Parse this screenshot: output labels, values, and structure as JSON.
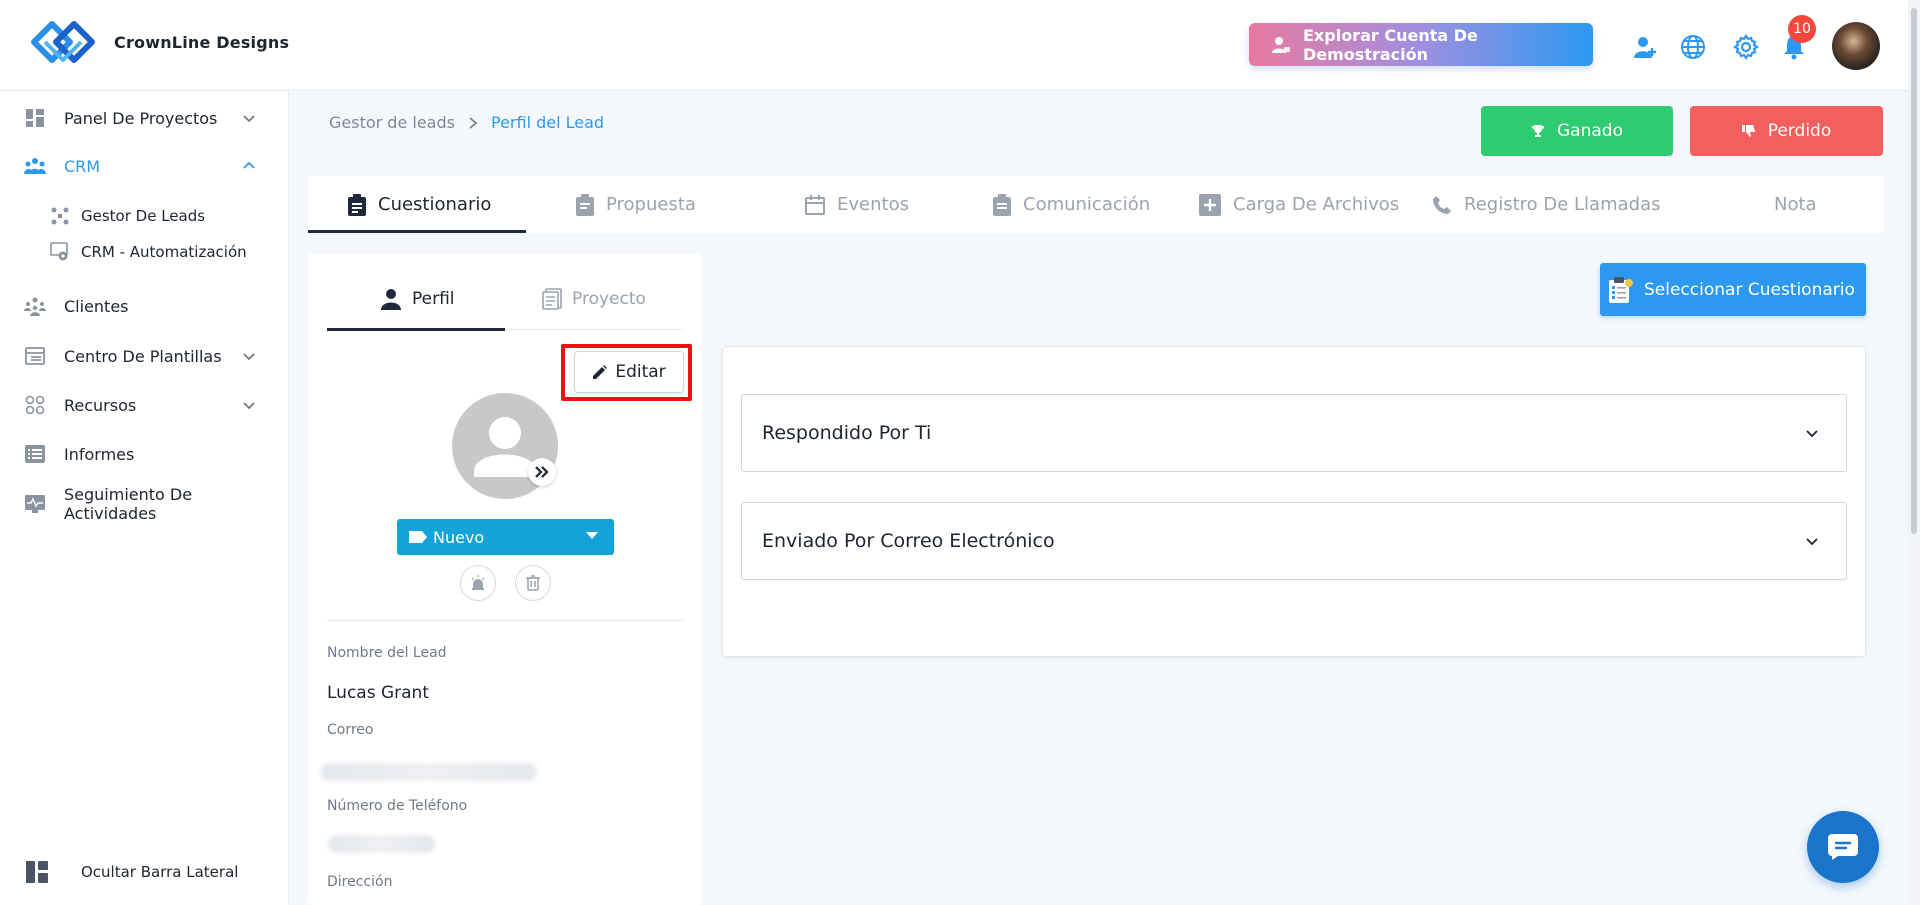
{
  "app": {
    "brand_name": "CrownLine Designs",
    "demo_button_label": "Explorar Cuenta De Demostración",
    "notification_count": "10"
  },
  "sidebar": {
    "items": [
      {
        "label": "Panel De Proyectos",
        "icon": "dashboard-grid-icon",
        "expandable": true
      },
      {
        "label": "CRM",
        "icon": "crm-people-icon",
        "expandable": true,
        "expanded": true,
        "active": true
      },
      {
        "label": "Gestor De Leads",
        "icon": "lead-manager-icon",
        "sub": true
      },
      {
        "label": "CRM - Automatización",
        "icon": "automation-gear-icon",
        "sub": true
      },
      {
        "label": "Clientes",
        "icon": "clients-group-icon"
      },
      {
        "label": "Centro De Plantillas",
        "icon": "template-center-icon",
        "expandable": true
      },
      {
        "label": "Recursos",
        "icon": "resources-icon",
        "expandable": true
      },
      {
        "label": "Informes",
        "icon": "reports-list-icon"
      },
      {
        "label": "Seguimiento De Actividades",
        "icon": "activity-tracking-icon"
      }
    ],
    "hide_label": "Ocultar Barra Lateral"
  },
  "breadcrumb": {
    "root": "Gestor de leads",
    "current": "Perfil del Lead"
  },
  "actions": {
    "won_label": "Ganado",
    "lost_label": "Perdido",
    "won_color": "#2ecc71",
    "lost_color": "#f25f5c"
  },
  "tabs": [
    {
      "label": "Cuestionario",
      "icon": "clipboard-list-icon",
      "active": true
    },
    {
      "label": "Propuesta",
      "icon": "proposal-icon"
    },
    {
      "label": "Eventos",
      "icon": "calendar-icon"
    },
    {
      "label": "Comunicación",
      "icon": "communication-clipboard-icon"
    },
    {
      "label": "Carga De Archivos",
      "icon": "plus-square-icon"
    },
    {
      "label": "Registro De Llamadas",
      "icon": "phone-icon"
    },
    {
      "label": "Nota",
      "icon": ""
    }
  ],
  "profile": {
    "tabs": [
      {
        "label": "Perfil",
        "active": true
      },
      {
        "label": "Proyecto"
      }
    ],
    "edit_label": "Editar",
    "status": "Nuevo",
    "fields": [
      {
        "label": "Nombre del Lead",
        "value": "Lucas Grant"
      },
      {
        "label": "Correo",
        "value": ""
      },
      {
        "label": "Número de Teléfono",
        "value": ""
      },
      {
        "label": "Dirección",
        "value": ""
      }
    ]
  },
  "questionnaire": {
    "select_label": "Seleccionar Cuestionario",
    "sections": [
      {
        "title": "Respondido Por Ti"
      },
      {
        "title": "Enviado Por Correo Electrónico"
      }
    ]
  }
}
